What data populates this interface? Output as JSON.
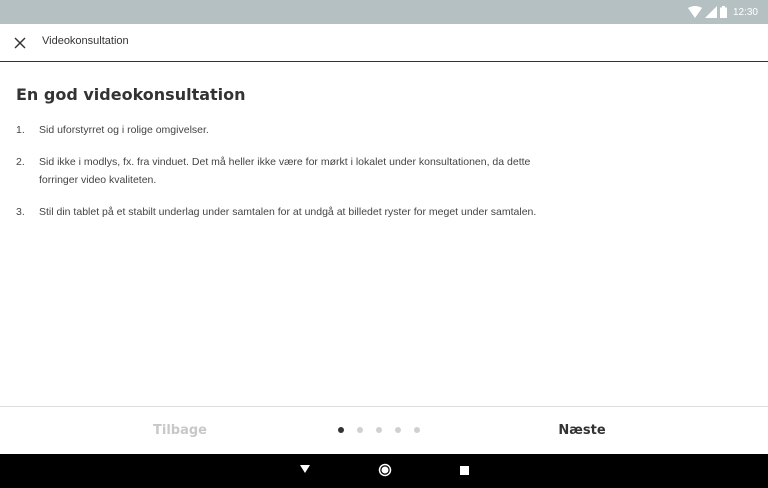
{
  "status_bar": {
    "time": "12:30",
    "icons": [
      "wifi-icon",
      "signal-icon",
      "battery-icon"
    ]
  },
  "app_bar": {
    "title": "Videokonsultation",
    "close_icon": "close-icon"
  },
  "content": {
    "heading": "En god videokonsultation",
    "items": [
      {
        "number": "1.",
        "text": "Sid uforstyrret og i rolige omgivelser."
      },
      {
        "number": "2.",
        "text": "Sid ikke i modlys, fx. fra vinduet. Det må heller ikke være for mørkt i lokalet under konsultationen, da dette forringer video kvaliteten."
      },
      {
        "number": "3.",
        "text": "Stil din tablet på et stabilt underlag under samtalen for at undgå at billedet ryster for meget under samtalen."
      }
    ]
  },
  "bottom_nav": {
    "back_label": "Tilbage",
    "next_label": "Næste",
    "pages_total": 5,
    "current_page": 1
  },
  "system_nav": {
    "icons": [
      "back-triangle-icon",
      "home-circle-icon",
      "recents-square-icon"
    ]
  },
  "colors": {
    "status_bar": "#b5c0c3",
    "text": "#333333",
    "disabled": "#c8c8c8",
    "system_nav": "#000000"
  }
}
